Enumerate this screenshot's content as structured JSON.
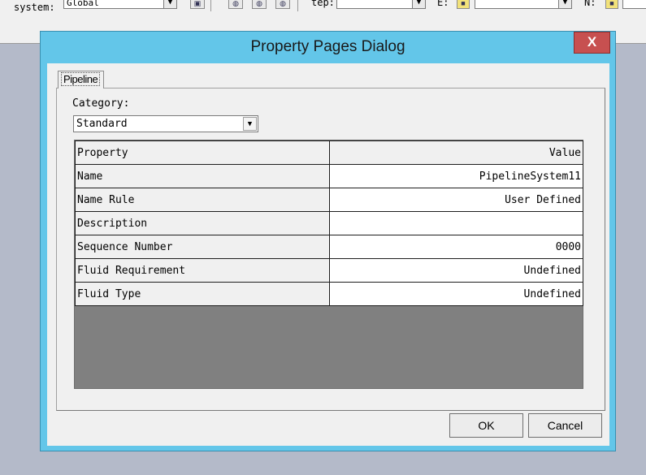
{
  "background_toolbar": {
    "system_label": "system:",
    "system_value": "Global",
    "step_label": "tep:",
    "step_value": "",
    "e_label": "E:",
    "e_value": "",
    "n_label": "N:"
  },
  "dialog": {
    "title": "Property Pages Dialog",
    "close_label": "X",
    "tabs": [
      {
        "label": "Pipeline",
        "selected": true
      }
    ],
    "category": {
      "label": "Category:",
      "value": "Standard"
    },
    "grid": {
      "header": {
        "property": "Property",
        "value": "Value"
      },
      "rows": [
        {
          "property": "Name",
          "value": "PipelineSystem11"
        },
        {
          "property": "Name Rule",
          "value": "User Defined"
        },
        {
          "property": "Description",
          "value": ""
        },
        {
          "property": "Sequence Number",
          "value": "0000"
        },
        {
          "property": "Fluid Requirement",
          "value": "Undefined"
        },
        {
          "property": "Fluid Type",
          "value": "Undefined"
        }
      ]
    },
    "buttons": {
      "ok": "OK",
      "cancel": "Cancel"
    }
  },
  "colors": {
    "dialog_frame": "#63c6e9",
    "close_button": "#c75050",
    "grid_background": "#808080",
    "desktop": "#b4bac9"
  }
}
